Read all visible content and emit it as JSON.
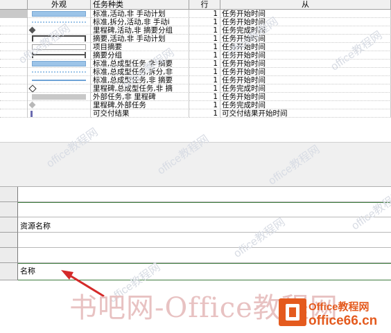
{
  "bar_styles": {
    "headers": {
      "appearance": "外观",
      "task_type": "任务种类",
      "row": "行",
      "from": "从"
    },
    "rows": [
      {
        "task": "标准,活动,非 手动计划",
        "row": "1",
        "from": "任务开始时间",
        "sample": "blue-bar"
      },
      {
        "task": "标准,拆分,活动,非 手动i",
        "row": "1",
        "from": "任务开始时间",
        "sample": "dotted-line"
      },
      {
        "task": "里程碑,活动,非 摘要分组",
        "row": "1",
        "from": "任务完成时间",
        "sample": "diamond-dark"
      },
      {
        "task": "摘要,活动,非 手动计划",
        "row": "1",
        "from": "任务开始时间",
        "sample": "summary-bracket"
      },
      {
        "task": "项目摘要",
        "row": "1",
        "from": "任务开始时间",
        "sample": "gray-outline-bar"
      },
      {
        "task": "摘要分组",
        "row": "1",
        "from": "任务开始时间",
        "sample": "group-bracket"
      },
      {
        "task": "标准,总成型任务,非 摘要",
        "row": "1",
        "from": "任务开始时间",
        "sample": "blue-bar"
      },
      {
        "task": "标准,总成型任务,拆分,非",
        "row": "1",
        "from": "任务开始时间",
        "sample": "dotted-line"
      },
      {
        "task": "标准,总成型任务,非 摘要",
        "row": "1",
        "from": "任务开始时间",
        "sample": "thin-blue-line"
      },
      {
        "task": "里程碑,总成型任务,非 摘",
        "row": "1",
        "from": "任务完成时间",
        "sample": "diamond-outline"
      },
      {
        "task": "外部任务,非 里程碑",
        "row": "1",
        "from": "任务开始时间",
        "sample": "light-gray-bar"
      },
      {
        "task": "里程碑,外部任务",
        "row": "1",
        "from": "任务完成时间",
        "sample": "diamond-light"
      },
      {
        "task": "可交付结果",
        "row": "1",
        "from": "可交付结果开始时间",
        "sample": "deliverable-mark"
      }
    ]
  },
  "text_grid": {
    "rows": [
      {
        "value": ""
      },
      {
        "value": ""
      },
      {
        "value": "资源名称"
      },
      {
        "value": ""
      },
      {
        "value": ""
      },
      {
        "value": "名称"
      }
    ]
  },
  "watermark": {
    "small": "office教程网",
    "big": "书吧网-Office教程网",
    "logo_line1": "Office教程网",
    "logo_line2": "office66.cn"
  },
  "colors": {
    "bar_blue": "#9cc4e8",
    "arrow_red": "#d42a2a",
    "grid_green": "#3c7a3c"
  }
}
